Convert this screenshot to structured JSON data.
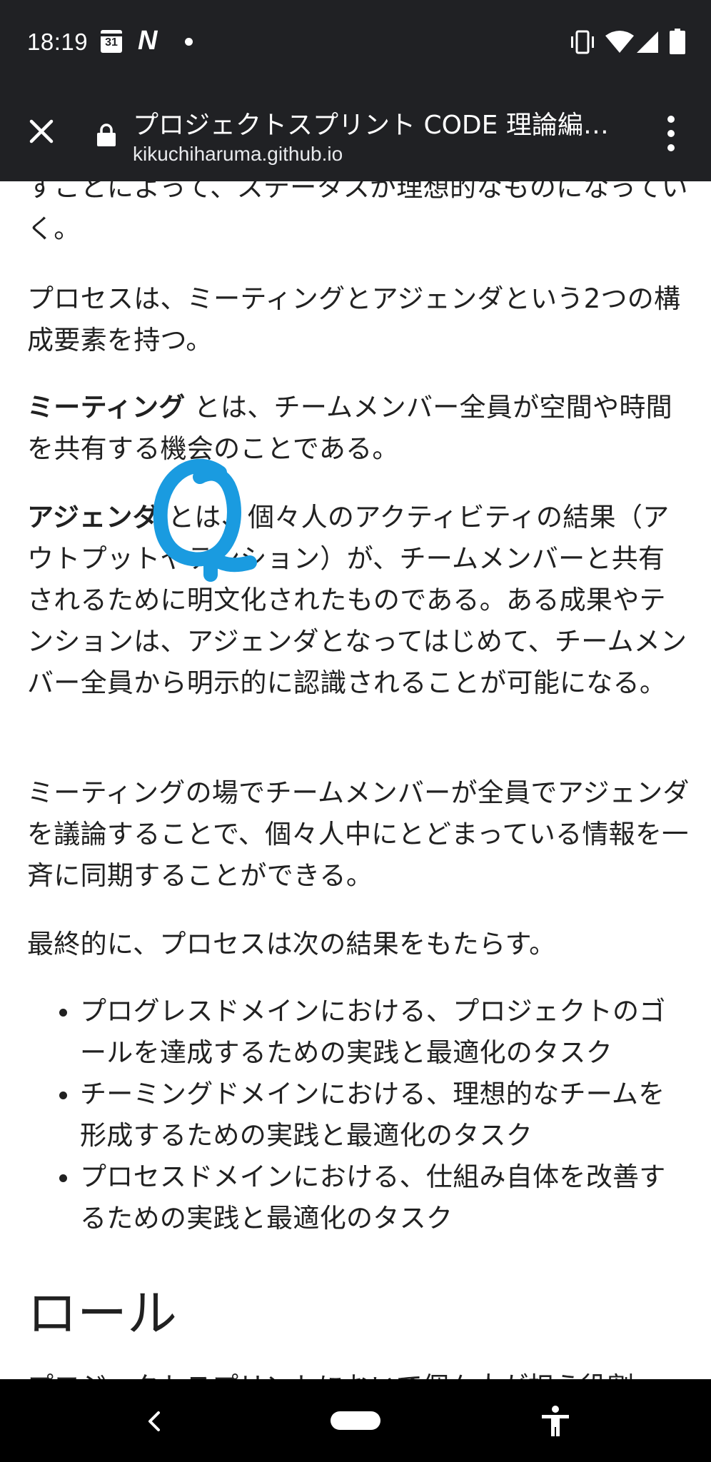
{
  "status_bar": {
    "time": "18:19",
    "calendar_day": "31",
    "notification_app": "N",
    "icons": [
      "calendar-icon",
      "n-app-icon",
      "dot-icon",
      "vibrate-icon",
      "wifi-icon",
      "signal-icon",
      "battery-icon"
    ]
  },
  "toolbar": {
    "title": "プロジェクトスプリント CODE 理論編…",
    "url": "kikuchiharuma.github.io",
    "icons": [
      "close-icon",
      "lock-icon",
      "more-vert-icon"
    ]
  },
  "content": {
    "p0": "すことによって、ステータスが理想的なものになっていく。",
    "p1": "プロセスは、ミーティングとアジェンダという2つの構成要素を持つ。",
    "p2_term": "ミーティング",
    "p2_rest": " とは、チームメンバー全員が空間や時間を共有する機会のことである。",
    "p3_term": "アジェンダ",
    "p3_rest": " とは、個々人のアクティビティの結果（アウトプットやテンション）が、チームメンバーと共有されるために明文化されたものである。ある成果やテンションは、アジェンダとなってはじめて、チームメンバー全員から明示的に認識されることが可能になる。",
    "p4": "ミーティングの場でチームメンバーが全員でアジェンダを議論することで、個々人中にとどまっている情報を一斉に同期することができる。",
    "p5": "最終的に、プロセスは次の結果をもたらす。",
    "list": [
      "プログレスドメインにおける、プロジェクトのゴールを達成するための実践と最適化のタスク",
      "チーミングドメインにおける、理想的なチームを形成するための実践と最適化のタスク",
      "プロセスドメインにおける、仕組み自体を改善するための実践と最適化のタスク"
    ],
    "heading": "ロール",
    "cutoff": "プロジェクトスプリントにおいて個々人が担う役割"
  },
  "annotation_color": "#1a9be0",
  "nav_bar": {
    "icons": [
      "back-icon",
      "home-pill",
      "accessibility-icon"
    ]
  }
}
